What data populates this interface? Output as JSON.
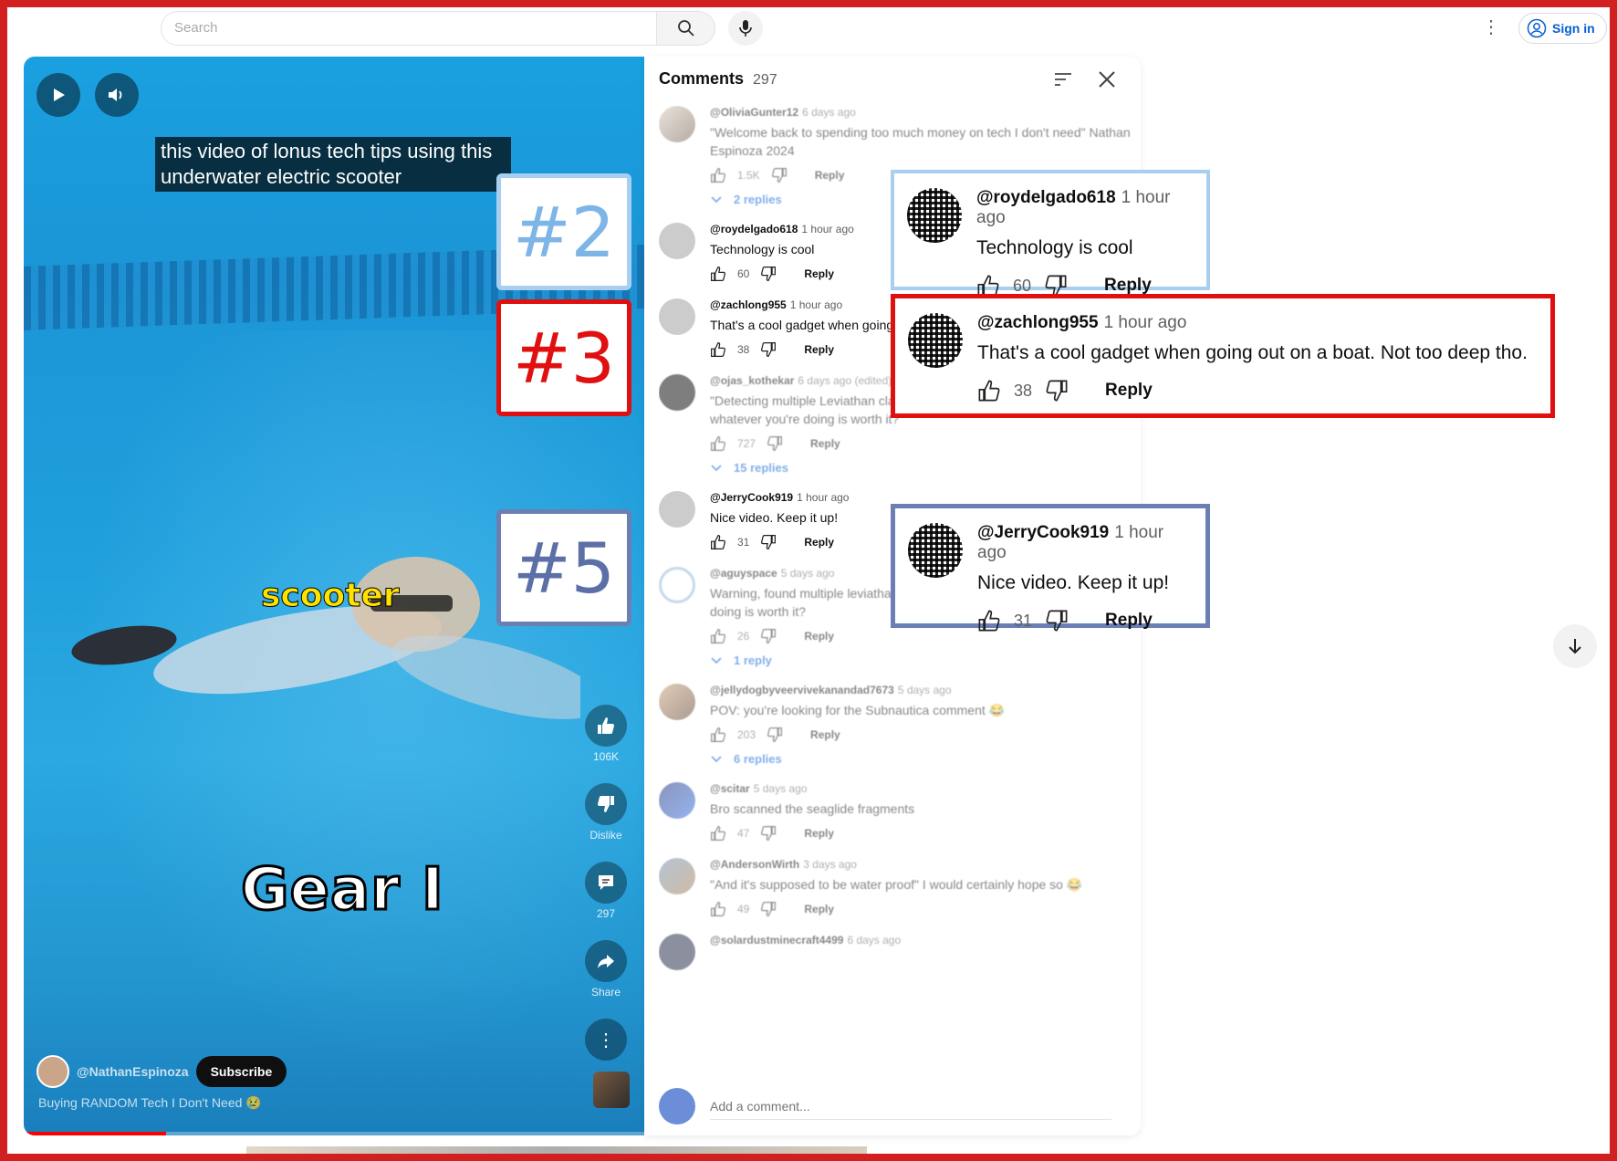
{
  "topbar": {
    "search_placeholder": "Search",
    "signin_label": "Sign in"
  },
  "video": {
    "caption": "this video of lonus tech tips using this underwater electric scooter",
    "overlay_scooter": "scooter",
    "overlay_gear": "Gear I",
    "channel_name": "@NathanEspinoza",
    "subscribe_label": "Subscribe",
    "title": "Buying RANDOM Tech I Don't Need 😢",
    "progress_fraction": 0.23,
    "actions": {
      "like_count": "106K",
      "dislike_label": "Dislike",
      "comments_count": "297",
      "share_label": "Share"
    }
  },
  "rank_labels": {
    "rank2": "#2",
    "rank3": "#3",
    "rank5": "#5"
  },
  "comments": {
    "title": "Comments",
    "count": "297",
    "add_placeholder": "Add a comment...",
    "items": [
      {
        "author": "@OliviaGunter12",
        "time": "6 days ago",
        "text": "\"Welcome back to spending too much money on tech I don't need\" Nathan Espinoza 2024",
        "likes": "1.5K",
        "reply": "Reply",
        "replies": "2 replies"
      },
      {
        "author": "@roydelgado618",
        "time": "1 hour ago",
        "text": "Technology is cool",
        "likes": "60",
        "reply": "Reply"
      },
      {
        "author": "@zachlong955",
        "time": "1 hour ago",
        "text": "That's a cool gadget when going",
        "likes": "38",
        "reply": "Reply"
      },
      {
        "author": "@ojas_kothekar",
        "time": "6 days ago (edited)",
        "text": "\"Detecting multiple Leviathan class lifeforms in the region, are you certain whatever you're doing is worth it?\"",
        "likes": "727",
        "reply": "Reply",
        "replies": "15 replies"
      },
      {
        "author": "@JerryCook919",
        "time": "1 hour ago",
        "text": "Nice video. Keep it up!",
        "likes": "31",
        "reply": "Reply"
      },
      {
        "author": "@aguyspace",
        "time": "5 days ago",
        "text": "Warning, found multiple leviathan lifeforms,are you sure whatever you doing is worth it?",
        "likes": "26",
        "reply": "Reply",
        "replies": "1 reply"
      },
      {
        "author": "@jellydogbyveervivekanandad7673",
        "time": "5 days ago",
        "text": "POV: you're looking for the Subnautica comment 😂",
        "likes": "203",
        "reply": "Reply",
        "replies": "6 replies"
      },
      {
        "author": "@scitar",
        "time": "5 days ago",
        "text": "Bro scanned the seaglide fragments",
        "likes": "47",
        "reply": "Reply"
      },
      {
        "author": "@AndersonWirth",
        "time": "3 days ago",
        "text": "\"And it's supposed to be water proof\" I would certainly hope so 😂",
        "likes": "49",
        "reply": "Reply"
      },
      {
        "author": "@solardustminecraft4499",
        "time": "6 days ago",
        "text": "",
        "likes": "",
        "reply": ""
      }
    ]
  },
  "highlights": {
    "h2": {
      "author": "@roydelgado618",
      "time": "1 hour ago",
      "text": "Technology is cool",
      "likes": "60",
      "reply": "Reply"
    },
    "h3": {
      "author": "@zachlong955",
      "time": "1 hour ago",
      "text": "That's a cool gadget when going out on a boat. Not too deep tho.",
      "likes": "38",
      "reply": "Reply"
    },
    "h5": {
      "author": "@JerryCook919",
      "time": "1 hour ago",
      "text": "Nice video. Keep it up!",
      "likes": "31",
      "reply": "Reply"
    }
  },
  "colors": {
    "frame": "#d21f1f",
    "rank2": "#a8cff0",
    "rank3": "#e01010",
    "rank5": "#6b7fb5",
    "link": "#065fd4"
  },
  "icons": [
    "search-icon",
    "mic-icon",
    "kebab-icon",
    "account-icon",
    "play-icon",
    "volume-icon",
    "like-icon",
    "dislike-icon",
    "comment-icon",
    "share-icon",
    "sort-icon",
    "close-icon",
    "chevron-down-icon",
    "arrow-down-icon"
  ]
}
